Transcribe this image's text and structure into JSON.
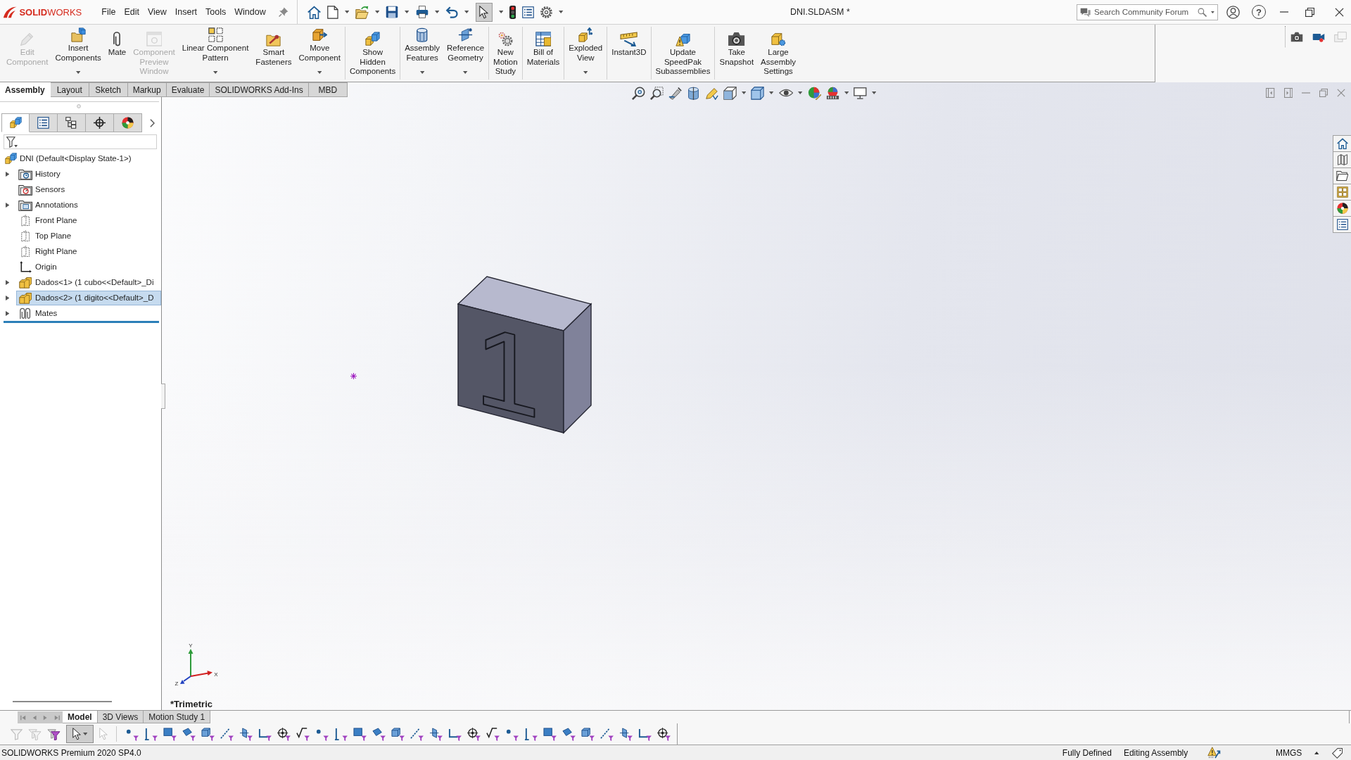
{
  "app": {
    "logo": "**SOLID**WORKS"
  },
  "menu": [
    {
      "label": "File"
    },
    {
      "label": "Edit"
    },
    {
      "label": "View"
    },
    {
      "label": "Insert"
    },
    {
      "label": "Tools"
    },
    {
      "label": "Window"
    }
  ],
  "quick_access": {
    "select_pressed": true
  },
  "window": {
    "title": "DNI.SLDASM *",
    "help": "?"
  },
  "search": {
    "placeholder": "Search Community Forum"
  },
  "command_manager": {
    "groups": [
      {
        "buttons": [
          {
            "label": "Edit\nComponent",
            "disabled": true,
            "dropdown": false
          },
          {
            "label": "Insert\nComponents",
            "disabled": false,
            "dropdown": true
          },
          {
            "label": "Mate",
            "disabled": false,
            "dropdown": false
          },
          {
            "label": "Component\nPreview\nWindow",
            "disabled": true,
            "dropdown": false
          },
          {
            "label": "Linear Component\nPattern",
            "disabled": false,
            "dropdown": true
          },
          {
            "label": "Smart\nFasteners",
            "disabled": false,
            "dropdown": false
          },
          {
            "label": "Move\nComponent",
            "disabled": false,
            "dropdown": true
          }
        ]
      },
      {
        "buttons": [
          {
            "label": "Show\nHidden\nComponents",
            "disabled": false,
            "dropdown": false
          }
        ]
      },
      {
        "buttons": [
          {
            "label": "Assembly\nFeatures",
            "disabled": false,
            "dropdown": true
          },
          {
            "label": "Reference\nGeometry",
            "disabled": false,
            "dropdown": true
          }
        ]
      },
      {
        "buttons": [
          {
            "label": "New\nMotion\nStudy",
            "disabled": false,
            "dropdown": false
          }
        ]
      },
      {
        "buttons": [
          {
            "label": "Bill of\nMaterials",
            "disabled": false,
            "dropdown": false
          }
        ]
      },
      {
        "buttons": [
          {
            "label": "Exploded\nView",
            "disabled": false,
            "dropdown": true
          }
        ]
      },
      {
        "buttons": [
          {
            "label": "Instant3D",
            "disabled": false,
            "dropdown": false
          }
        ]
      },
      {
        "buttons": [
          {
            "label": "Update\nSpeedPak\nSubassemblies",
            "disabled": false,
            "dropdown": false
          }
        ]
      },
      {
        "buttons": [
          {
            "label": "Take\nSnapshot",
            "disabled": false,
            "dropdown": false
          },
          {
            "label": "Large\nAssembly\nSettings",
            "disabled": false,
            "dropdown": false
          }
        ]
      }
    ]
  },
  "tabs": [
    {
      "label": "Assembly",
      "selected": true
    },
    {
      "label": "Layout",
      "selected": false
    },
    {
      "label": "Sketch",
      "selected": false
    },
    {
      "label": "Markup",
      "selected": false
    },
    {
      "label": "Evaluate",
      "selected": false
    },
    {
      "label": "SOLIDWORKS Add-Ins",
      "selected": false
    },
    {
      "label": "MBD",
      "selected": false
    }
  ],
  "feature_tree": {
    "panel_tabs": [
      {
        "selected": true
      },
      {
        "selected": false
      },
      {
        "selected": false
      },
      {
        "selected": false
      },
      {
        "selected": false
      }
    ],
    "root": {
      "label": "DNI (Default<Display State-1>)",
      "kind": "assembly",
      "selected": false,
      "children": [
        {
          "label": "History",
          "kind": "history",
          "expanded": false,
          "selected": false
        },
        {
          "label": "Sensors",
          "kind": "sensors",
          "selected": false
        },
        {
          "label": "Annotations",
          "kind": "annotations",
          "expanded": false,
          "selected": false
        },
        {
          "label": "Front Plane",
          "kind": "plane",
          "selected": false
        },
        {
          "label": "Top Plane",
          "kind": "plane",
          "selected": false
        },
        {
          "label": "Right Plane",
          "kind": "plane",
          "selected": false
        },
        {
          "label": "Origin",
          "kind": "origin",
          "selected": false
        },
        {
          "label": "Dados<1> (1 cubo<<Default>_Di",
          "kind": "component",
          "expanded": false,
          "selected": false
        },
        {
          "label": "Dados<2> (1 digito<<Default>_D",
          "kind": "component",
          "expanded": false,
          "selected": true
        },
        {
          "label": "Mates",
          "kind": "mates",
          "expanded": false,
          "selected": false
        }
      ]
    }
  },
  "graphics": {
    "model": {
      "digit": "1"
    },
    "triad": {
      "x": "X",
      "y": "Y",
      "z": "Z"
    },
    "view_name": "*Trimetric"
  },
  "bottom_tabs": [
    {
      "label": "Model",
      "selected": true
    },
    {
      "label": "3D Views",
      "selected": false
    },
    {
      "label": "Motion Study 1",
      "selected": false
    }
  ],
  "filter_toolbar": {
    "select_pressed": true
  },
  "status_bar": {
    "product": "SOLIDWORKS Premium 2020 SP4.0",
    "state": "Fully Defined",
    "mode": "Editing Assembly",
    "units": "MMGS"
  }
}
